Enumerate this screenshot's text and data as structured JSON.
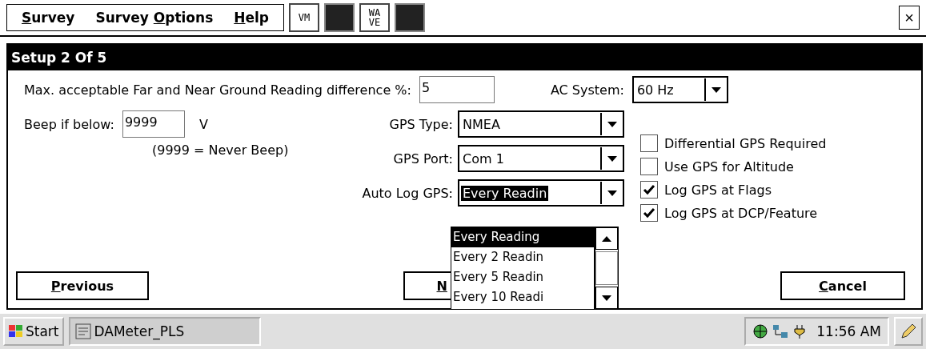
{
  "menu": [
    {
      "label": "Survey"
    },
    {
      "label": "Survey Options"
    },
    {
      "label": "Help"
    }
  ],
  "toolbar": [
    {
      "kind": "text",
      "label": "VM"
    },
    {
      "kind": "dark"
    },
    {
      "kind": "text",
      "label": "WAVE"
    },
    {
      "kind": "dark"
    }
  ],
  "close": "×",
  "dialog": {
    "title": "Setup 2 Of 5",
    "difference": {
      "label": "Max. acceptable Far and Near Ground Reading difference %:",
      "value": "5"
    },
    "ac_system": {
      "label": "AC  System:",
      "value": "60 Hz"
    },
    "beep": {
      "label": "Beep if below:",
      "value": "9999",
      "unit": "V",
      "note": "(9999 = Never Beep)"
    },
    "combos": [
      {
        "label": "GPS Type:",
        "value": "NMEA",
        "focused": false
      },
      {
        "label": "GPS Port:",
        "value": "Com 1",
        "focused": false
      },
      {
        "label": "Auto Log GPS:",
        "value": "Every Readin",
        "focused": true
      }
    ],
    "dropdown_list": [
      {
        "label": "Every Reading",
        "selected": true
      },
      {
        "label": "Every 2 Readin",
        "selected": false
      },
      {
        "label": "Every 5 Readin",
        "selected": false
      },
      {
        "label": "Every 10 Readi",
        "selected": false
      }
    ],
    "checkboxes": [
      {
        "label": "Differential GPS Required",
        "checked": false
      },
      {
        "label": "Use GPS for Altitude",
        "checked": false
      },
      {
        "label": "Log GPS at Flags",
        "checked": true
      },
      {
        "label": "Log GPS at DCP/Feature",
        "checked": true
      }
    ],
    "buttons": [
      {
        "label": "Previous"
      },
      {
        "label": "N"
      },
      {
        "label": "Cancel"
      }
    ]
  },
  "taskbar": {
    "start": "Start",
    "task": "DAMeter_PLS",
    "time": "11:56 AM"
  }
}
